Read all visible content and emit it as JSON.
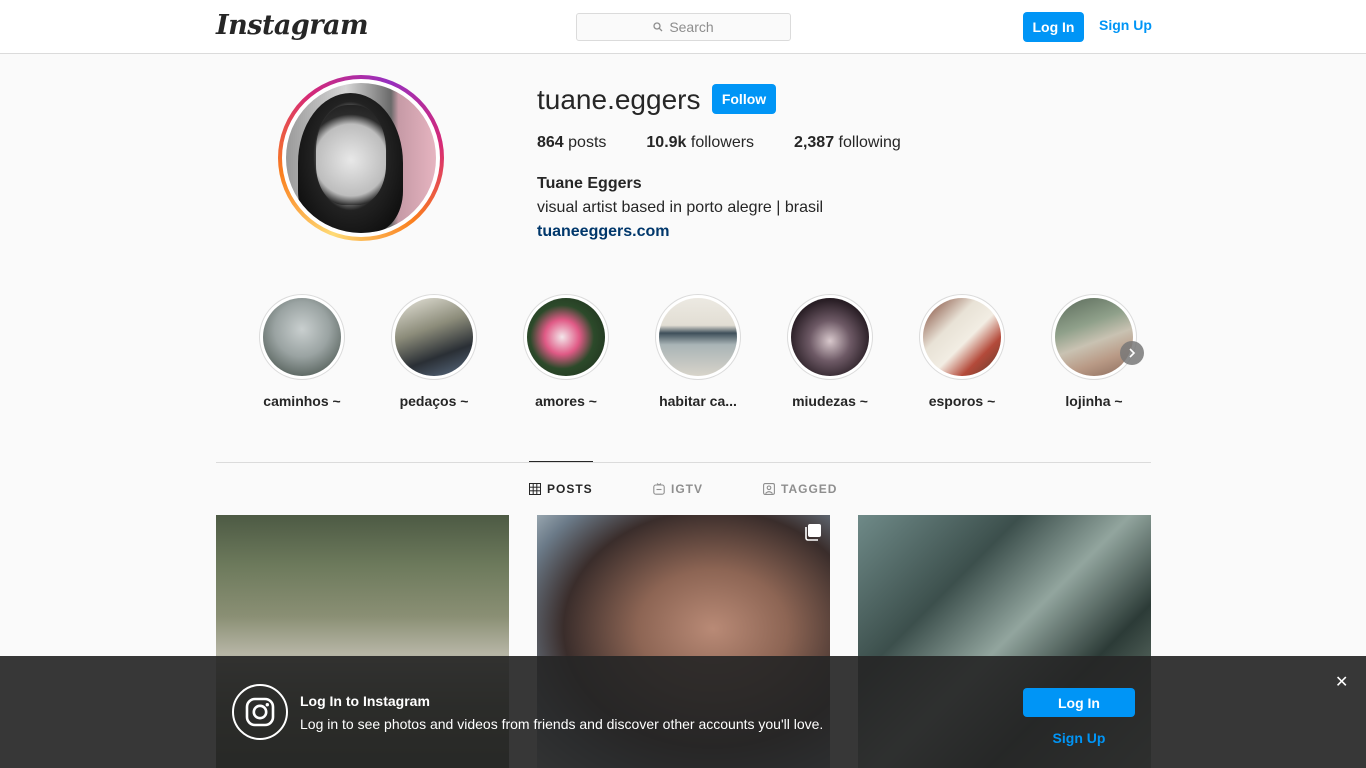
{
  "nav": {
    "logo_text": "Instagram",
    "search_placeholder": "Search",
    "login_label": "Log In",
    "signup_label": "Sign Up"
  },
  "profile": {
    "username": "tuane.eggers",
    "follow_label": "Follow",
    "stats": [
      {
        "value": "864",
        "label": "posts"
      },
      {
        "value": "10.9k",
        "label": "followers"
      },
      {
        "value": "2,387",
        "label": "following"
      }
    ],
    "full_name": "Tuane Eggers",
    "bio": "visual artist based in porto alegre | brasil",
    "website": "tuaneeggers.com"
  },
  "highlights": [
    {
      "label": "caminhos ~"
    },
    {
      "label": "pedaços ~"
    },
    {
      "label": "amores ~"
    },
    {
      "label": "habitar ca..."
    },
    {
      "label": "miudezas ~"
    },
    {
      "label": "esporos ~"
    },
    {
      "label": "lojinha ~"
    }
  ],
  "tabs": [
    {
      "label": "POSTS",
      "icon": "grid-icon",
      "active": true
    },
    {
      "label": "IGTV",
      "icon": "igtv-icon",
      "active": false
    },
    {
      "label": "TAGGED",
      "icon": "tagged-icon",
      "active": false
    }
  ],
  "posts": [
    {
      "icon": null
    },
    {
      "icon": "carousel-icon"
    },
    {
      "icon": null
    }
  ],
  "login_banner": {
    "title": "Log In to Instagram",
    "text": "Log in to see photos and videos from friends and discover other accounts you'll love.",
    "login_label": "Log In",
    "signup_label": "Sign Up",
    "close_glyph": "✕"
  },
  "colors": {
    "accent": "#0095f6",
    "link": "#00376b",
    "text": "#262626",
    "muted": "#8e8e8e"
  }
}
